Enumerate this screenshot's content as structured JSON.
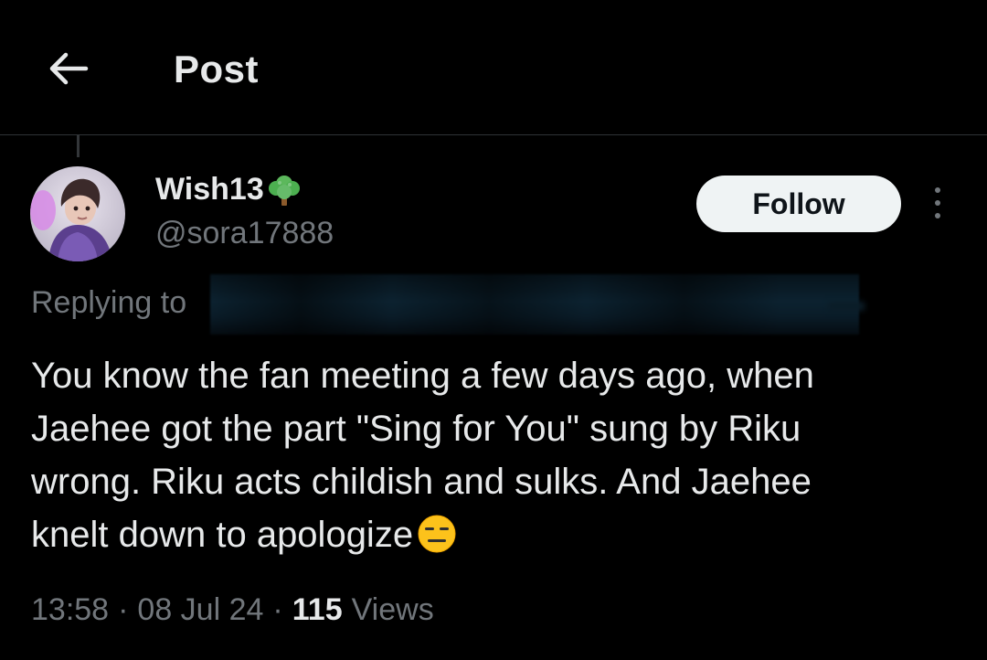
{
  "header": {
    "title": "Post",
    "back_icon": "arrow-left-icon"
  },
  "author": {
    "display_name": "Wish13",
    "name_emoji": "tree-emoji",
    "handle": "@sora17888",
    "avatar": "profile-photo"
  },
  "follow_button": {
    "label": "Follow"
  },
  "more_icon": "more-vertical-icon",
  "replying": {
    "prefix": "Replying to"
  },
  "post": {
    "lines": [
      "You know the fan meeting a few days ago, when",
      "Jaehee got the part \"Sing for You\" sung by Riku",
      "wrong. Riku acts childish and sulks. And Jaehee",
      "knelt down to apologize"
    ],
    "trailing_emoji": "expressionless-face-emoji"
  },
  "meta": {
    "time": "13:58",
    "separator": "·",
    "date": "08 Jul 24",
    "views_count": "115",
    "views_label": "Views"
  },
  "colors": {
    "background": "#000000",
    "primary_text": "#e7e9ea",
    "secondary_text": "#71767b",
    "follow_bg": "#eff3f4",
    "divider": "#2f3336"
  }
}
